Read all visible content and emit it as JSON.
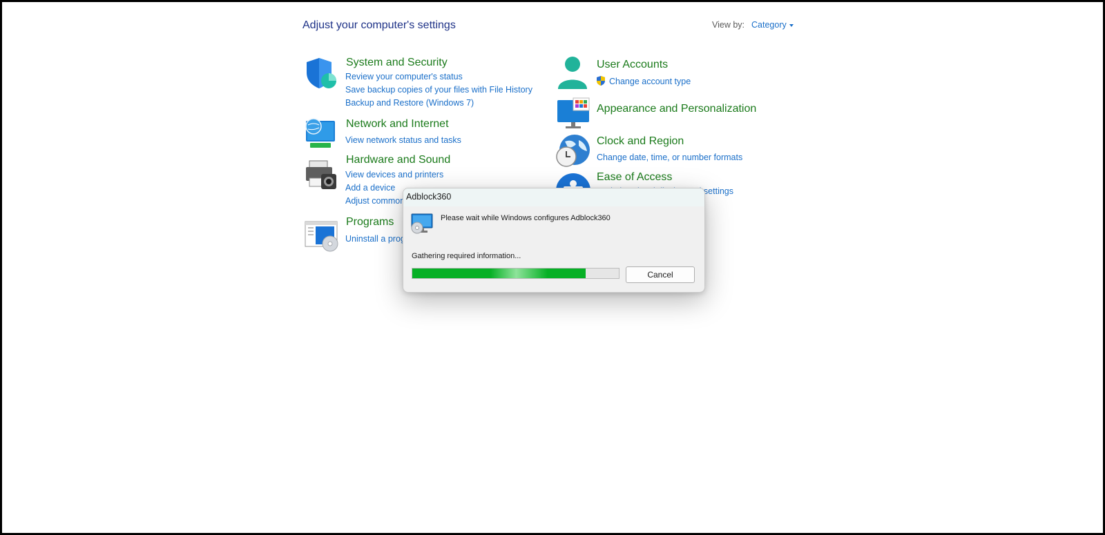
{
  "page": {
    "title": "Adjust your computer's settings"
  },
  "viewby": {
    "label": "View by:",
    "value": "Category"
  },
  "categories": {
    "system_security": {
      "title": "System and Security",
      "links": [
        "Review your computer's status",
        "Save backup copies of your files with File History",
        "Backup and Restore (Windows 7)"
      ]
    },
    "network": {
      "title": "Network and Internet",
      "links": [
        "View network status and tasks"
      ]
    },
    "hardware": {
      "title": "Hardware and Sound",
      "links": [
        "View devices and printers",
        "Add a device",
        "Adjust common sound settings"
      ]
    },
    "programs": {
      "title": "Programs",
      "links": [
        "Uninstall a program"
      ]
    },
    "user_accounts": {
      "title": "User Accounts",
      "links": [
        "Change account type"
      ]
    },
    "appearance": {
      "title": "Appearance and Personalization"
    },
    "clock": {
      "title": "Clock and Region",
      "links": [
        "Change date, time, or number formats"
      ]
    },
    "ease": {
      "title": "Ease of Access",
      "links": [
        "Optimize visual display and settings"
      ]
    }
  },
  "dialog": {
    "title": "Adblock360",
    "message": "Please wait while Windows configures Adblock360",
    "status": "Gathering required information...",
    "progress_percent": 84,
    "cancel_label": "Cancel"
  },
  "colors": {
    "heading": "#1e3287",
    "category_title": "#1a7a1a",
    "link": "#1a6fc9",
    "progress": "#06b025"
  }
}
